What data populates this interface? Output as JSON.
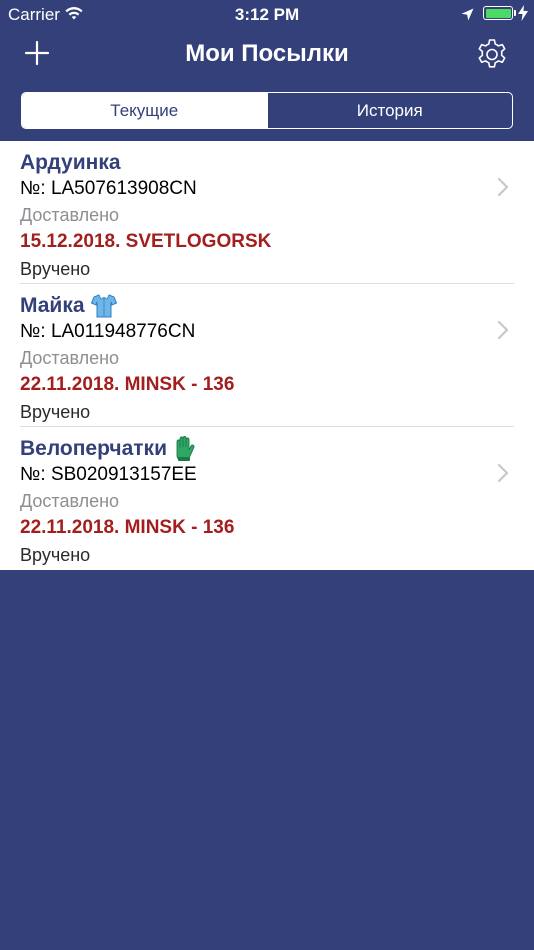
{
  "status_bar": {
    "carrier": "Carrier",
    "time": "3:12 PM",
    "battery_level": 1.0
  },
  "nav": {
    "title": "Мои Посылки",
    "add_icon": "plus-icon",
    "settings_icon": "gear-icon"
  },
  "segments": [
    {
      "label": "Текущие",
      "selected": true
    },
    {
      "label": "История",
      "selected": false
    }
  ],
  "parcels": [
    {
      "name": "Ардуинка",
      "emoji": "",
      "number": "№: LA507613908CN",
      "status": "Доставлено",
      "location": "15.12.2018. SVETLOGORSK",
      "result": "Вручено"
    },
    {
      "name": "Майка",
      "emoji": "shirt-icon",
      "number": "№: LA011948776CN",
      "status": "Доставлено",
      "location": "22.11.2018. MINSK - 136",
      "result": "Вручено"
    },
    {
      "name": "Велоперчатки",
      "emoji": "glove-icon",
      "number": "№: SB020913157EE",
      "status": "Доставлено",
      "location": "22.11.2018. MINSK - 136",
      "result": "Вручено"
    }
  ],
  "colors": {
    "background": "#34407a",
    "title_text": "#34407a",
    "location_text": "#a31e1e",
    "status_gray": "#8e8e93",
    "battery": "#4cd964"
  }
}
